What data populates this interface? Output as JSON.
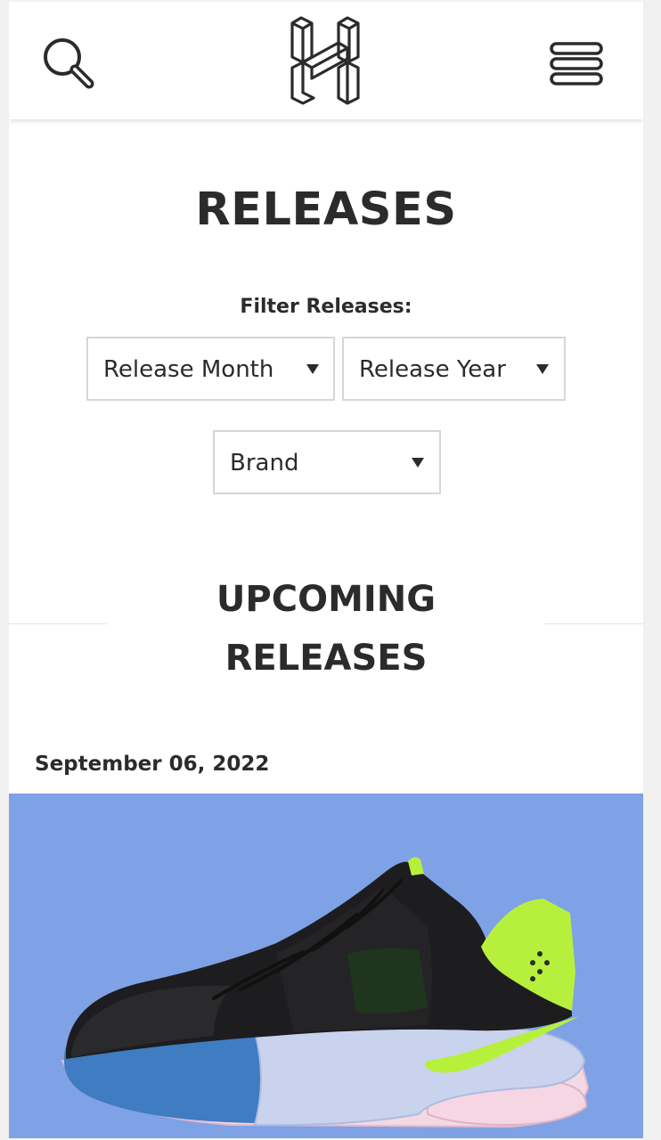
{
  "header": {
    "search_icon": "search-icon",
    "logo_icon": "hypebeast-h-logo",
    "menu_icon": "hamburger-menu-icon"
  },
  "page": {
    "title": "RELEASES"
  },
  "filters": {
    "label": "Filter Releases:",
    "release_month": "Release Month",
    "release_year": "Release Year",
    "brand": "Brand"
  },
  "upcoming": {
    "title_line1": "UPCOMING",
    "title_line2": "RELEASES"
  },
  "releases": [
    {
      "date": "September 06, 2022",
      "image_icon": "sneaker-image",
      "background_color": "#7fa1e6"
    }
  ],
  "colors": {
    "text": "#2b2b2b",
    "border": "#d6d6d6",
    "image_bg": "#7fa1e6",
    "accent_volt": "#b7f03c"
  }
}
